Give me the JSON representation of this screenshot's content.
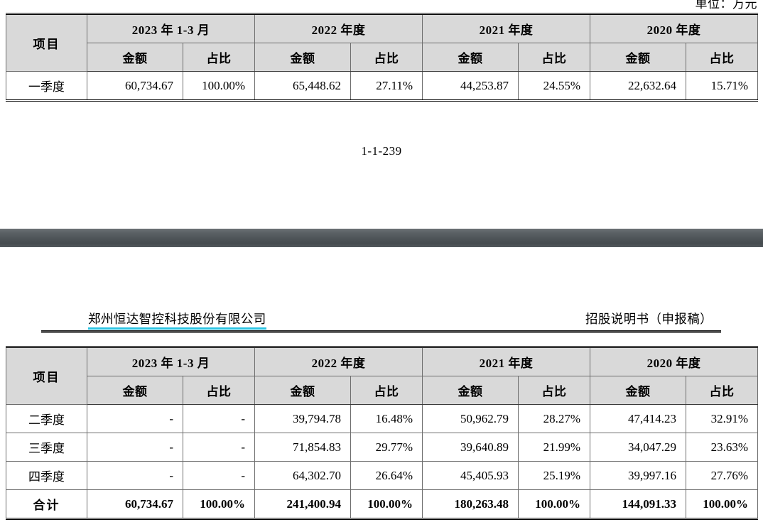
{
  "document": {
    "unit_note": "单位：万元",
    "page_number": "1-1-239",
    "header_left": "郑州恒达智控科技股份有限公司",
    "header_right": "招股说明书（申报稿）",
    "highlight_color": "#2cc4e2",
    "header_bg": "#d9d9d9",
    "separator_color": "#4d5357"
  },
  "table_headers": {
    "item": "项目",
    "periods": [
      "2023 年 1-3 月",
      "2022 年度",
      "2021 年度",
      "2020 年度"
    ],
    "amount": "金额",
    "ratio": "占比"
  },
  "table_one": {
    "rows": [
      {
        "label": "一季度",
        "cells": [
          "60,734.67",
          "100.00%",
          "65,448.62",
          "27.11%",
          "44,253.87",
          "24.55%",
          "22,632.64",
          "15.71%"
        ]
      }
    ]
  },
  "table_two": {
    "rows": [
      {
        "label": "二季度",
        "cells": [
          "-",
          "-",
          "39,794.78",
          "16.48%",
          "50,962.79",
          "28.27%",
          "47,414.23",
          "32.91%"
        ]
      },
      {
        "label": "三季度",
        "cells": [
          "-",
          "-",
          "71,854.83",
          "29.77%",
          "39,640.89",
          "21.99%",
          "34,047.29",
          "23.63%"
        ]
      },
      {
        "label": "四季度",
        "cells": [
          "-",
          "-",
          "64,302.70",
          "26.64%",
          "45,405.93",
          "25.19%",
          "39,997.16",
          "27.76%"
        ]
      },
      {
        "label": "合计",
        "total": true,
        "cells": [
          "60,734.67",
          "100.00%",
          "241,400.94",
          "100.00%",
          "180,263.48",
          "100.00%",
          "144,091.33",
          "100.00%"
        ]
      }
    ]
  }
}
